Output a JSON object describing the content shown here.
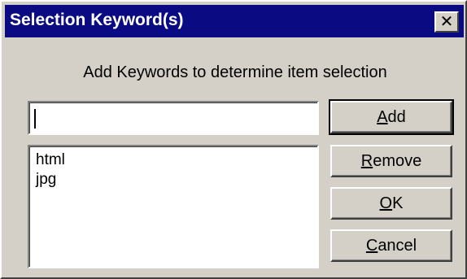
{
  "window": {
    "title": "Selection Keyword(s)",
    "close_glyph": "✕"
  },
  "prompt": "Add Keywords to determine item selection",
  "input": {
    "value": ""
  },
  "keywords": [
    "html",
    "jpg"
  ],
  "buttons": {
    "add": {
      "mnemonic": "A",
      "rest": "dd"
    },
    "remove": {
      "mnemonic": "R",
      "rest": "emove"
    },
    "ok": {
      "mnemonic": "O",
      "rest": "K"
    },
    "cancel": {
      "mnemonic": "C",
      "rest": "ancel"
    }
  },
  "colors": {
    "titlebar": "#0a0a82",
    "face": "#d4d0c8"
  }
}
